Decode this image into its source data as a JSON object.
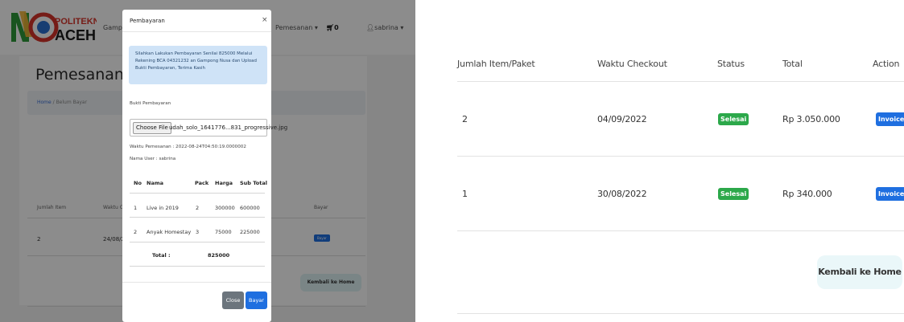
{
  "underlying_page": {
    "nav": {
      "gampong": "Gampong",
      "pemesanan": "Pemesanan ▾",
      "cart": "0",
      "user": "sabrina ▾"
    },
    "logo_text": "POLITEKNIK ACEH",
    "title": "Pemesanan",
    "breadcrumb": {
      "home": "Home",
      "separator": " / ",
      "current": "Belum Bayar"
    },
    "table_headers": [
      "Jumlah Item",
      "Waktu Chec",
      "Bayar"
    ],
    "row": {
      "jumlah": "2",
      "waktu": "24/08/2022",
      "action": "Bayar"
    },
    "home_button": "Kembali ke Home"
  },
  "modal": {
    "title": "Pembayaran",
    "close_icon": "×",
    "alert": "Silahkan Lakukan Pembayaran Senilai 825000 Melalui Rekening BCA 04321232 an Gampong Nusa dan Upload Bukti Pembayaran, Terima Kasih",
    "bukti_label": "Bukti Pembayaran",
    "file_button": "Choose File",
    "file_name": "udah_solo_1641776...831_progressive.jpg",
    "waktu_label": "Waktu Pemesanan : 2022-08-24T04:50:19.0000002",
    "user_label": "Nama User : sabrina",
    "table": {
      "headers": [
        "No",
        "Nama",
        "Pack",
        "Harga",
        "Sub Total"
      ],
      "rows": [
        [
          "1",
          "Live in 2019",
          "2",
          "300000",
          "600000"
        ],
        [
          "2",
          "Anyak Homestay",
          "3",
          "75000",
          "225000"
        ]
      ],
      "total_label": "Total :",
      "total_value": "825000"
    },
    "close_button": "Close",
    "bayar_button": "Bayar"
  },
  "orders_table": {
    "headers": [
      "Jumlah Item/Paket",
      "Waktu Checkout",
      "Status",
      "Total",
      "Action"
    ],
    "rows": [
      {
        "jumlah": "2",
        "waktu": "04/09/2022",
        "status": "Selesai",
        "total": "Rp 3.050.000",
        "action": "Invoice"
      },
      {
        "jumlah": "1",
        "waktu": "30/08/2022",
        "status": "Selesai",
        "total": "Rp 340.000",
        "action": "Invoice"
      }
    ],
    "home_button": "Kembali ke Home"
  },
  "colors": {
    "primary": "#1f6fe0",
    "success": "#2ca84a",
    "secondary": "#6c757d",
    "alert_bg": "#cfe3f7"
  }
}
